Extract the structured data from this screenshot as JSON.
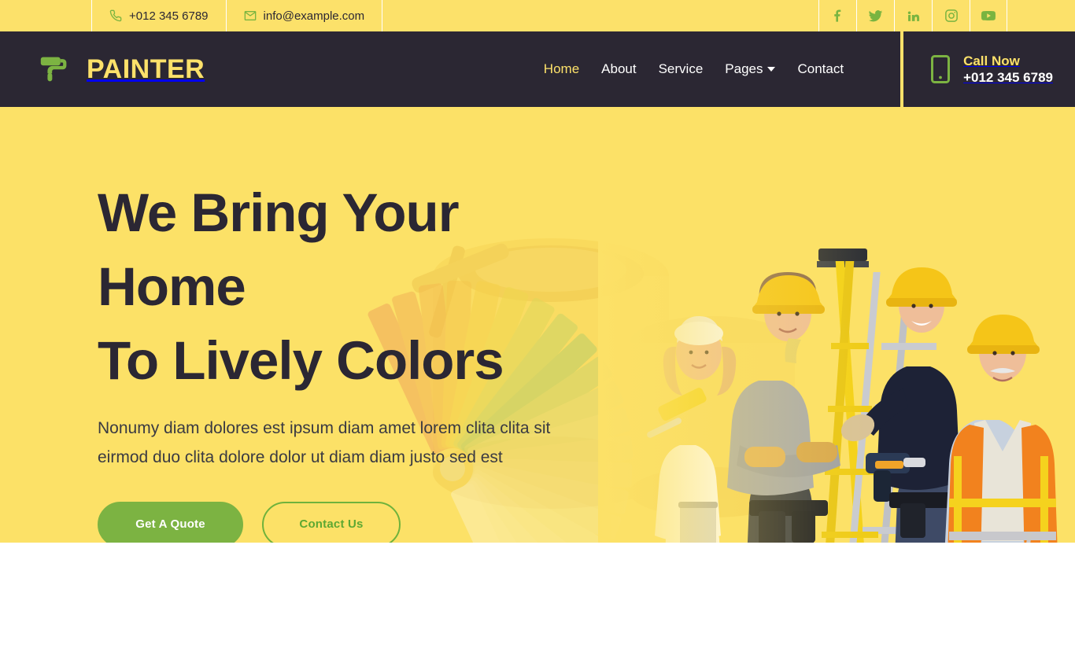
{
  "topbar": {
    "phone": {
      "icon": "phone-icon",
      "text": "+012 345 6789"
    },
    "email": {
      "icon": "envelope-icon",
      "text": "info@example.com"
    },
    "social": [
      {
        "name": "facebook-icon",
        "label": "Facebook"
      },
      {
        "name": "twitter-icon",
        "label": "Twitter"
      },
      {
        "name": "linkedin-icon",
        "label": "LinkedIn"
      },
      {
        "name": "instagram-icon",
        "label": "Instagram"
      },
      {
        "name": "youtube-icon",
        "label": "YouTube"
      }
    ]
  },
  "navbar": {
    "brand": {
      "icon": "paint-roller-icon",
      "text": "PAINTER"
    },
    "links": [
      {
        "label": "Home",
        "active": true,
        "dropdown": false
      },
      {
        "label": "About",
        "active": false,
        "dropdown": false
      },
      {
        "label": "Service",
        "active": false,
        "dropdown": false
      },
      {
        "label": "Pages",
        "active": false,
        "dropdown": true
      },
      {
        "label": "Contact",
        "active": false,
        "dropdown": false
      }
    ],
    "call": {
      "icon": "mobile-phone-icon",
      "label": "Call Now",
      "number": "+012 345 6789"
    }
  },
  "hero": {
    "title_line_1": "We Bring Your Home",
    "title_line_2": "To Lively Colors",
    "subtitle_line_1": "Nonumy diam dolores est ipsum diam amet lorem clita clita sit",
    "subtitle_line_2": "eirmod duo clita dolore dolor ut diam diam justo sed est",
    "primary_button": "Get A Quote",
    "secondary_button": "Contact Us",
    "image_alt": "four-painters-with-ladder-photo"
  },
  "colors": {
    "yellow": "#FCE167",
    "yellow_topbar": "#FCE16A",
    "dark": "#2B2733",
    "green": "#7CB342",
    "green_light": "#8CC044",
    "white": "#FFFFFF"
  }
}
